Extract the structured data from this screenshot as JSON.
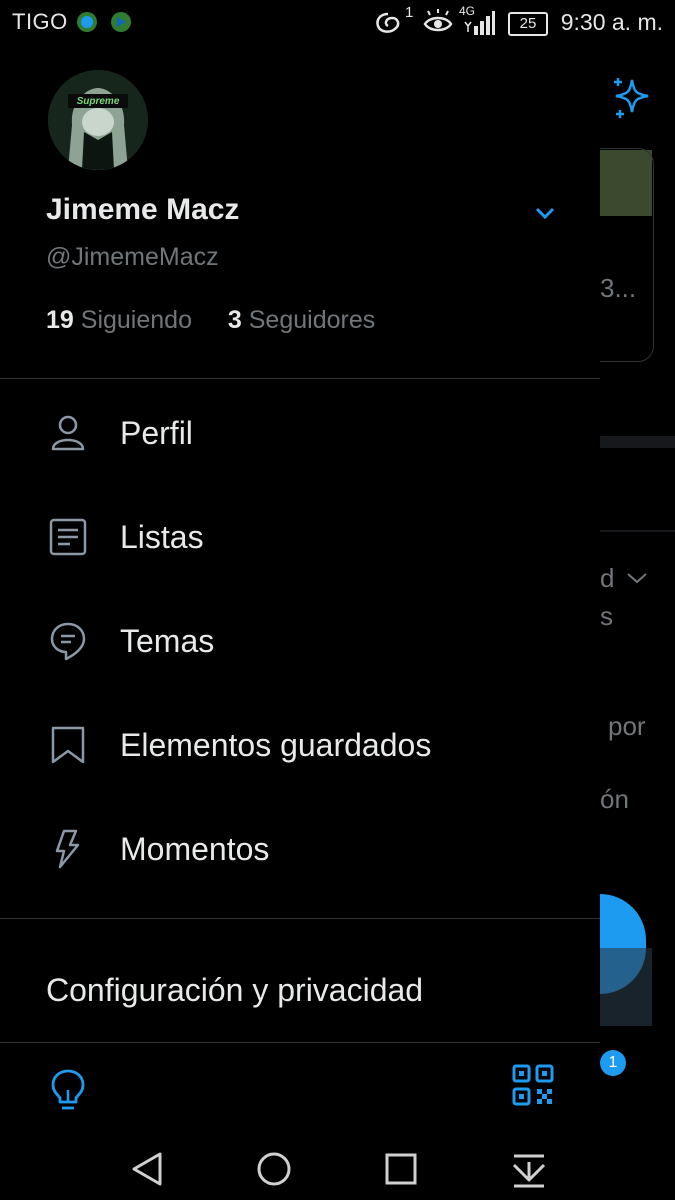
{
  "status_bar": {
    "carrier": "TIGO",
    "notification_count": "1",
    "network": "4G",
    "battery": "25",
    "time": "9:30 a. m."
  },
  "profile": {
    "display_name": "Jimeme Macz",
    "handle": "@JimemeMacz",
    "avatar_text": "Supreme",
    "following_count": "19",
    "following_label": "Siguiendo",
    "followers_count": "3",
    "followers_label": "Seguidores"
  },
  "menu": {
    "items": [
      {
        "label": "Perfil",
        "icon": "person-icon"
      },
      {
        "label": "Listas",
        "icon": "list-icon"
      },
      {
        "label": "Temas",
        "icon": "topics-icon"
      },
      {
        "label": "Elementos guardados",
        "icon": "bookmark-icon"
      },
      {
        "label": "Momentos",
        "icon": "lightning-icon"
      }
    ],
    "settings_label": "Configuración y privacidad"
  },
  "background": {
    "snippet_1": "3...",
    "snippet_2": "d",
    "snippet_3": "s",
    "snippet_4": "por",
    "snippet_5": "ón",
    "badge": "1"
  },
  "colors": {
    "accent": "#1d9bf0",
    "background": "#000000",
    "text_primary": "#e7e9ea",
    "text_secondary": "#71767b",
    "divider": "#2f3336"
  }
}
